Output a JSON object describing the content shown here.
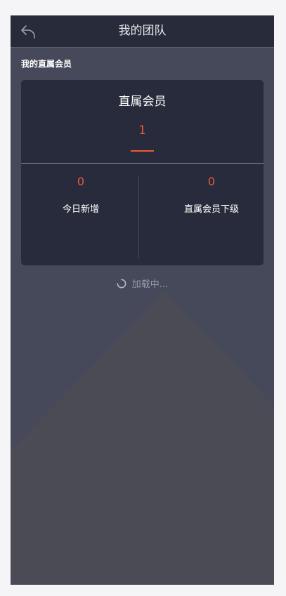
{
  "header": {
    "title": "我的团队"
  },
  "section": {
    "label": "我的直属会员"
  },
  "card": {
    "title": "直属会员",
    "count": "1",
    "stats": [
      {
        "value": "0",
        "label": "今日新增"
      },
      {
        "value": "0",
        "label": "直属会员下级"
      }
    ]
  },
  "loading": {
    "text": "加载中..."
  },
  "colors": {
    "accent": "#ee5a3a",
    "header_bg": "#272b3a",
    "page_bg": "#464959",
    "card_bg": "#272b3b"
  },
  "icons": {
    "back": "back-arrow-icon",
    "loading": "spinner-icon"
  }
}
